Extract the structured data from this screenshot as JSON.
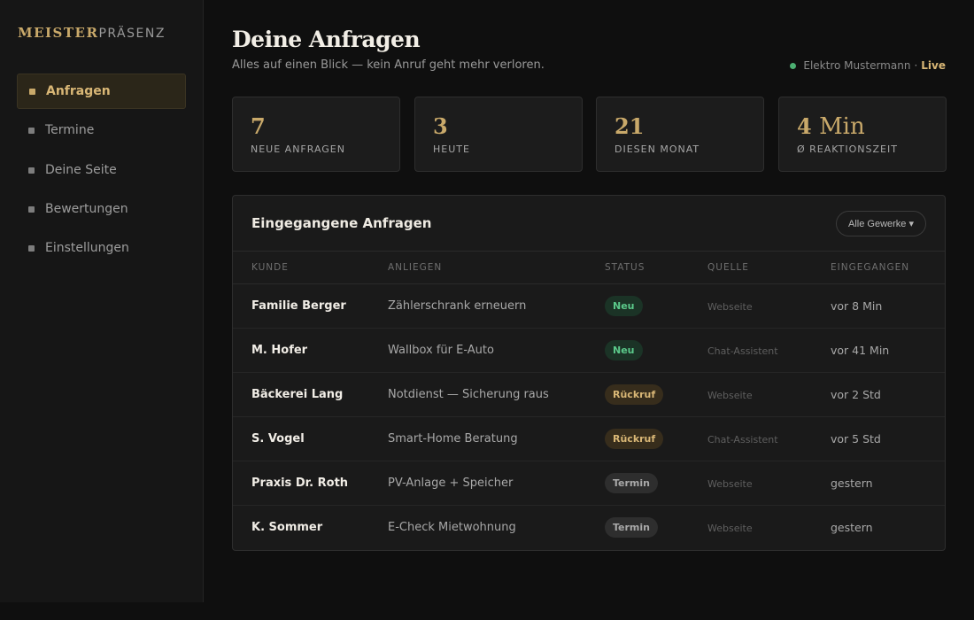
{
  "brand": {
    "strong": "MEISTER",
    "light": "PRÄSENZ"
  },
  "sidebar": {
    "items": [
      {
        "label": "Anfragen",
        "active": true
      },
      {
        "label": "Termine",
        "active": false
      },
      {
        "label": "Deine Seite",
        "active": false
      },
      {
        "label": "Bewertungen",
        "active": false
      },
      {
        "label": "Einstellungen",
        "active": false
      }
    ]
  },
  "header": {
    "title": "Deine Anfragen",
    "subtitle": "Alles auf einen Blick — kein Anruf geht mehr verloren.",
    "company": "Elektro Mustermann",
    "separator": "·",
    "status": "Live",
    "status_color": "#4caf72"
  },
  "stats": [
    {
      "value": "7",
      "label": "NEUE ANFRAGEN"
    },
    {
      "value": "3",
      "label": "HEUTE"
    },
    {
      "value": "21",
      "label": "DIESEN MONAT"
    },
    {
      "value": "4",
      "value_unit": "Min",
      "label": "Ø REAKTIONSZEIT"
    }
  ],
  "table": {
    "title": "Eingegangene Anfragen",
    "filter_label": "Alle Gewerke ▾",
    "columns": [
      "KUNDE",
      "ANLIEGEN",
      "STATUS",
      "QUELLE",
      "EINGEGANGEN"
    ],
    "rows": [
      {
        "kunde": "Familie Berger",
        "anliegen": "Zählerschrank erneuern",
        "status": "Neu",
        "status_type": "neu",
        "quelle": "Webseite",
        "zeit": "vor 8 Min"
      },
      {
        "kunde": "M. Hofer",
        "anliegen": "Wallbox für E-Auto",
        "status": "Neu",
        "status_type": "neu",
        "quelle": "Chat-Assistent",
        "zeit": "vor 41 Min"
      },
      {
        "kunde": "Bäckerei Lang",
        "anliegen": "Notdienst — Sicherung raus",
        "status": "Rückruf",
        "status_type": "rueckruf",
        "quelle": "Webseite",
        "zeit": "vor 2 Std"
      },
      {
        "kunde": "S. Vogel",
        "anliegen": "Smart-Home Beratung",
        "status": "Rückruf",
        "status_type": "rueckruf",
        "quelle": "Chat-Assistent",
        "zeit": "vor 5 Std"
      },
      {
        "kunde": "Praxis Dr. Roth",
        "anliegen": "PV-Anlage + Speicher",
        "status": "Termin",
        "status_type": "termin",
        "quelle": "Webseite",
        "zeit": "gestern"
      },
      {
        "kunde": "K. Sommer",
        "anliegen": "E-Check Mietwohnung",
        "status": "Termin",
        "status_type": "termin",
        "quelle": "Webseite",
        "zeit": "gestern"
      }
    ]
  },
  "colors": {
    "accent": "#c9a96a",
    "background": "#0f0f0f",
    "status_neu": "#5bc98a",
    "status_rueckruf": "#d9b776",
    "status_termin": "#a9a9a9"
  }
}
